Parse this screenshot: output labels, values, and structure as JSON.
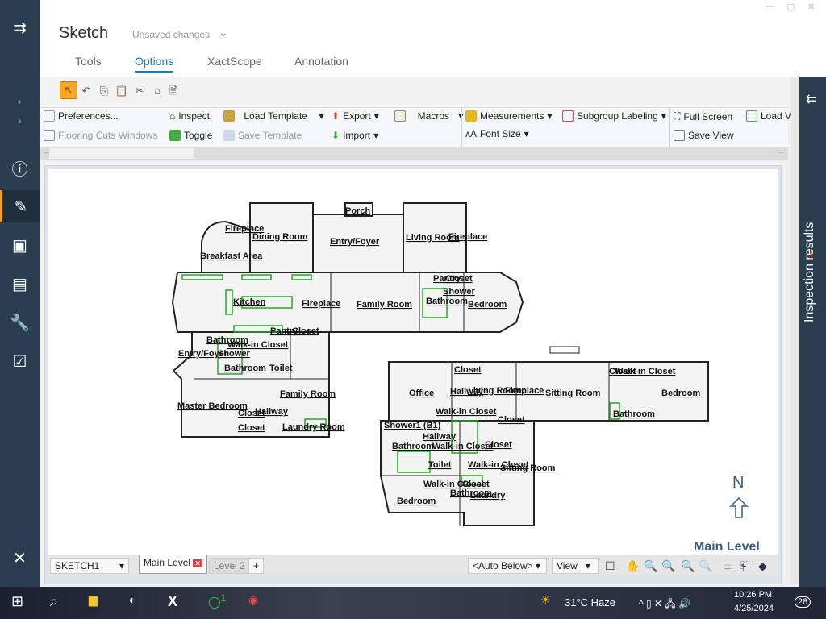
{
  "app": {
    "title": "Sketch",
    "status": "Unsaved changes"
  },
  "tabs": [
    {
      "label": "Tools"
    },
    {
      "label": "Options",
      "selected": true
    },
    {
      "label": "XactScope"
    },
    {
      "label": "Annotation"
    }
  ],
  "ribbon": {
    "preferences": "Preferences...",
    "flooring_cuts": "Flooring Cuts Windows",
    "inspect": "Inspect",
    "toggle": "Toggle",
    "load_template": "Load Template",
    "save_template": "Save Template",
    "export": "Export",
    "import": "Import",
    "macros": "Macros",
    "measurements": "Measurements",
    "font_size": "Font Size",
    "subgroup_labeling": "Subgroup Labeling",
    "full_screen": "Full Screen",
    "save_view": "Save View",
    "load_view": "Load V"
  },
  "right_panel": {
    "title": "Inspection results",
    "alert": "!"
  },
  "plan": {
    "level_label": "Main Level",
    "north": "N",
    "rooms": [
      "Fireplace",
      "Dining Room",
      "Porch",
      "Entry/Foyer",
      "Living Room",
      "Fireplace",
      "Breakfast Area",
      "Pantry",
      "Closet",
      "Shower",
      "Kitchen",
      "Fireplace",
      "Family Room",
      "Bathroom",
      "Bedroom",
      "Pantry",
      "Closet",
      "Bathroom",
      "Walk-in Closet",
      "Entry/Foyer",
      "Shower",
      "Bathroom",
      "Toilet",
      "Family Room",
      "Master Bedroom",
      "Hallway",
      "Closet",
      "Closet",
      "Laundry Room",
      "Closet",
      "Closet",
      "Walk-in Closet",
      "Office",
      "Hallway",
      "Living Room",
      "Fireplace",
      "Sitting Room",
      "Bedroom",
      "Walk-in Closet",
      "Closet",
      "Bathroom",
      "Shower1 (B1)",
      "Hallway",
      "Bathroom",
      "Walk-in Closet",
      "Closet",
      "Toilet",
      "Walk-in Closet",
      "Sitting Room",
      "Walk-in Closet",
      "Closet",
      "Bathroom",
      "Laundry",
      "Bedroom"
    ]
  },
  "bottom": {
    "sketch": "SKETCH1",
    "levels": [
      "Main Level",
      "Level 2"
    ],
    "add": "+",
    "auto_below": "<Auto Below>",
    "view": "View"
  },
  "taskbar": {
    "weather": "31°C  Haze",
    "time": "10:26 PM",
    "date": "4/25/2024",
    "badge_whatsapp": "1",
    "notifications": "28"
  }
}
